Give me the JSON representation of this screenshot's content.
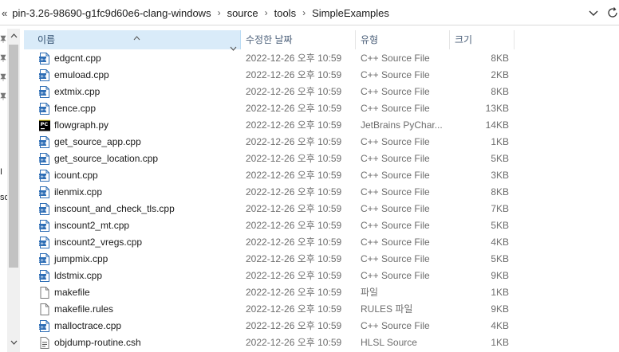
{
  "address_bar": {
    "overflow_glyph": "«",
    "path": [
      "pin-3.26-98690-g1fc9d60e6-clang-windows",
      "source",
      "tools",
      "SimpleExamples"
    ],
    "separator": "›"
  },
  "nav": {
    "clipped_labels": [
      "I",
      "so"
    ]
  },
  "columns": {
    "name": "이름",
    "date": "수정한 날짜",
    "type": "유형",
    "size": "크기"
  },
  "colors": {
    "header_selected_bg": "#d9ebf9",
    "cpp_icon": "#2d6db5",
    "pycharm_icon": "#000000",
    "muted_text": "#6d6d6d"
  },
  "files": [
    {
      "name": "edgcnt.cpp",
      "date": "2022-12-26 오후 10:59",
      "type": "C++ Source File",
      "size": "8KB",
      "icon": "cpp-file-icon"
    },
    {
      "name": "emuload.cpp",
      "date": "2022-12-26 오후 10:59",
      "type": "C++ Source File",
      "size": "2KB",
      "icon": "cpp-file-icon"
    },
    {
      "name": "extmix.cpp",
      "date": "2022-12-26 오후 10:59",
      "type": "C++ Source File",
      "size": "8KB",
      "icon": "cpp-file-icon"
    },
    {
      "name": "fence.cpp",
      "date": "2022-12-26 오후 10:59",
      "type": "C++ Source File",
      "size": "13KB",
      "icon": "cpp-file-icon"
    },
    {
      "name": "flowgraph.py",
      "date": "2022-12-26 오후 10:59",
      "type": "JetBrains PyChar...",
      "size": "14KB",
      "icon": "pycharm-file-icon"
    },
    {
      "name": "get_source_app.cpp",
      "date": "2022-12-26 오후 10:59",
      "type": "C++ Source File",
      "size": "1KB",
      "icon": "cpp-file-icon"
    },
    {
      "name": "get_source_location.cpp",
      "date": "2022-12-26 오후 10:59",
      "type": "C++ Source File",
      "size": "5KB",
      "icon": "cpp-file-icon"
    },
    {
      "name": "icount.cpp",
      "date": "2022-12-26 오후 10:59",
      "type": "C++ Source File",
      "size": "3KB",
      "icon": "cpp-file-icon"
    },
    {
      "name": "ilenmix.cpp",
      "date": "2022-12-26 오후 10:59",
      "type": "C++ Source File",
      "size": "8KB",
      "icon": "cpp-file-icon"
    },
    {
      "name": "inscount_and_check_tls.cpp",
      "date": "2022-12-26 오후 10:59",
      "type": "C++ Source File",
      "size": "7KB",
      "icon": "cpp-file-icon"
    },
    {
      "name": "inscount2_mt.cpp",
      "date": "2022-12-26 오후 10:59",
      "type": "C++ Source File",
      "size": "5KB",
      "icon": "cpp-file-icon"
    },
    {
      "name": "inscount2_vregs.cpp",
      "date": "2022-12-26 오후 10:59",
      "type": "C++ Source File",
      "size": "4KB",
      "icon": "cpp-file-icon"
    },
    {
      "name": "jumpmix.cpp",
      "date": "2022-12-26 오후 10:59",
      "type": "C++ Source File",
      "size": "5KB",
      "icon": "cpp-file-icon"
    },
    {
      "name": "ldstmix.cpp",
      "date": "2022-12-26 오후 10:59",
      "type": "C++ Source File",
      "size": "9KB",
      "icon": "cpp-file-icon"
    },
    {
      "name": "makefile",
      "date": "2022-12-26 오후 10:59",
      "type": "파일",
      "size": "1KB",
      "icon": "blank-file-icon"
    },
    {
      "name": "makefile.rules",
      "date": "2022-12-26 오후 10:59",
      "type": "RULES 파일",
      "size": "9KB",
      "icon": "blank-file-icon"
    },
    {
      "name": "malloctrace.cpp",
      "date": "2022-12-26 오후 10:59",
      "type": "C++ Source File",
      "size": "4KB",
      "icon": "cpp-file-icon"
    },
    {
      "name": "objdump-routine.csh",
      "date": "2022-12-26 오후 10:59",
      "type": "HLSL Source",
      "size": "1KB",
      "icon": "script-file-icon"
    }
  ]
}
